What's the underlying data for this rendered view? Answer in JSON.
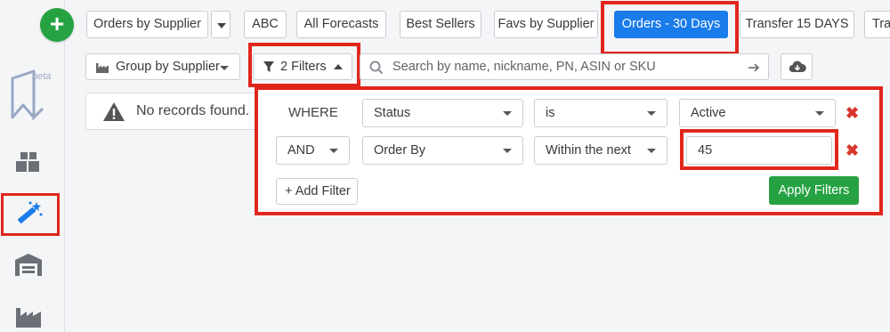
{
  "toolbar": {
    "tabs": [
      {
        "label": "Orders by Supplier",
        "active": false
      },
      {
        "label": "ABC",
        "active": false
      },
      {
        "label": "All Forecasts",
        "active": false
      },
      {
        "label": "Best Sellers",
        "active": false
      },
      {
        "label": "Favs by Supplier",
        "active": false
      },
      {
        "label": "Orders - 30 Days",
        "active": true
      },
      {
        "label": "Transfer 15 DAYS",
        "active": false
      },
      {
        "label": "Tra",
        "active": false
      }
    ],
    "add_label": "+",
    "group_by_label": "Group by Supplier",
    "filters_label": "2 Filters",
    "search_placeholder": "Search by name, nickname, PN, ASIN or SKU"
  },
  "sidebar": {
    "beta_label": "beta"
  },
  "results": {
    "empty_message": "No records found."
  },
  "filters": {
    "rows": [
      {
        "conjunction": "WHERE",
        "field": "Status",
        "operator": "is",
        "value": "Active"
      },
      {
        "conjunction": "AND",
        "field": "Order By",
        "operator": "Within the next",
        "value": "45"
      }
    ],
    "add_filter_label": "+ Add Filter",
    "apply_label": "Apply Filters",
    "remove_symbol": "✖"
  },
  "colors": {
    "accent_blue": "#1a7bea",
    "green": "#26a243",
    "highlight_red": "#e1261c",
    "remove_red": "#d9362b"
  },
  "icons": [
    "plus-icon",
    "boxes-icon",
    "magic-wand-icon",
    "warehouse-icon",
    "factory-icon",
    "filter-icon",
    "search-icon",
    "arrow-right-icon",
    "cloud-download-icon",
    "warning-icon",
    "caret-down-icon",
    "caret-up-icon"
  ]
}
